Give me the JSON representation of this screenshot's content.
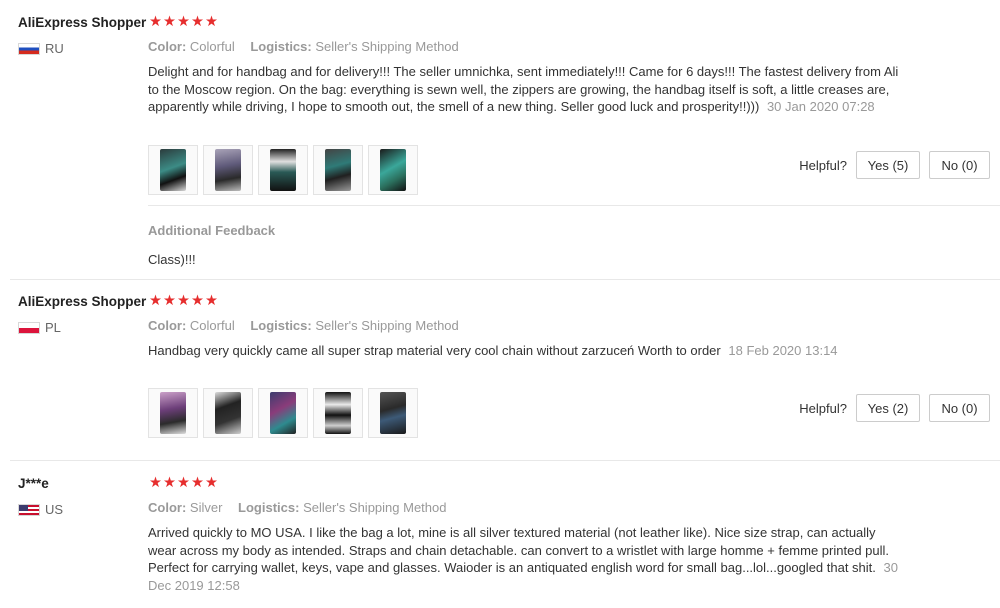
{
  "labels": {
    "color": "Color:",
    "logistics": "Logistics:",
    "helpful": "Helpful?",
    "additional_feedback": "Additional Feedback"
  },
  "colors": {
    "star": "#e62e2e",
    "muted_text": "#999999",
    "body_text": "#333333"
  },
  "reviews": [
    {
      "user": "AliExpress Shopper",
      "country": "RU",
      "flag_icon": "russia-flag-icon",
      "rating": 5,
      "stars": "★★★★★",
      "color_value": "Colorful",
      "logistics_value": "Seller's Shipping Method",
      "text": "Delight and for handbag and for delivery!!! The seller umnichka, sent immediately!!! Came for 6 days!!! The fastest delivery from Ali to the Moscow region. On the bag: everything is sewn well, the zippers are growing, the handbag itself is soft, a little creases are, apparently while driving, I hope to smooth out, the smell of a new thing. Seller good luck and prosperity!!)))",
      "date": "30 Jan 2020 07:28",
      "photo_count": 5,
      "yes_label": "Yes (5)",
      "no_label": "No (0)",
      "additional_feedback": "Class)!!!"
    },
    {
      "user": "AliExpress Shopper",
      "country": "PL",
      "flag_icon": "poland-flag-icon",
      "rating": 5,
      "stars": "★★★★★",
      "color_value": "Colorful",
      "logistics_value": "Seller's Shipping Method",
      "text": "Handbag very quickly came all super strap material very cool chain without zarzuceń Worth to order",
      "date": "18 Feb 2020 13:14",
      "photo_count": 5,
      "yes_label": "Yes (2)",
      "no_label": "No (0)"
    },
    {
      "user": "J***e",
      "country": "US",
      "flag_icon": "usa-flag-icon",
      "rating": 5,
      "stars": "★★★★★",
      "color_value": "Silver",
      "logistics_value": "Seller's Shipping Method",
      "text": "Arrived quickly to MO USA. I like the bag a lot, mine is all silver textured material (not leather like). Nice size strap, can actually wear across my body as intended. Straps and chain detachable. can convert to a wristlet with large homme + femme printed pull. Perfect for carrying wallet, keys, vape and glasses. Waioder is an antiquated english word for small bag...lol...googled that shit.",
      "date": "30 Dec 2019 12:58"
    }
  ]
}
